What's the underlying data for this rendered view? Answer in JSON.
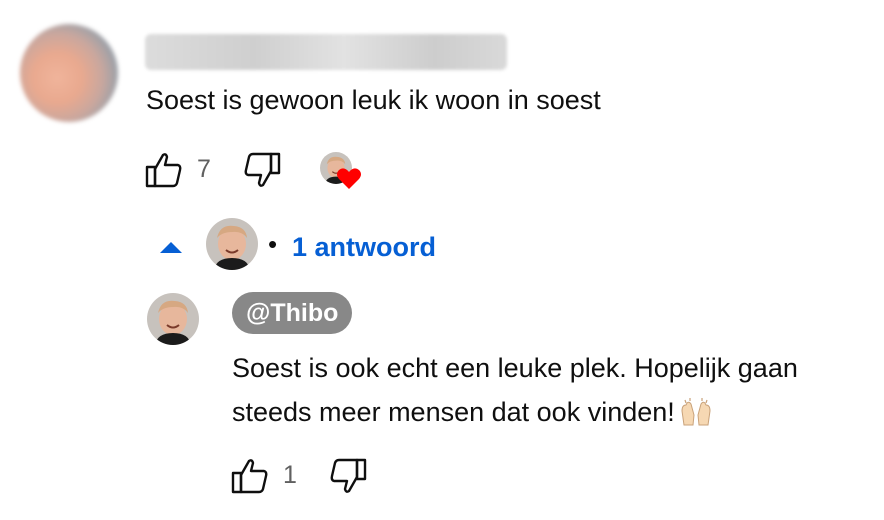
{
  "comment": {
    "text": "Soest is gewoon leuk ik woon in soest",
    "like_count": "7"
  },
  "replies_toggle": {
    "dot": "•",
    "label": "1 antwoord"
  },
  "reply": {
    "author": "@Thibo",
    "text": "Soest is ook echt een leuke plek. Hopelijk gaan steeds meer mensen dat ook vinden!",
    "like_count": "1"
  },
  "colors": {
    "link_blue": "#065fd4",
    "heart_red": "#ff0000",
    "author_chip_gray": "#888888"
  },
  "icons": [
    "thumbs-up-icon",
    "thumbs-down-icon",
    "heart-icon",
    "caret-up-icon",
    "raised-hands-emoji"
  ]
}
